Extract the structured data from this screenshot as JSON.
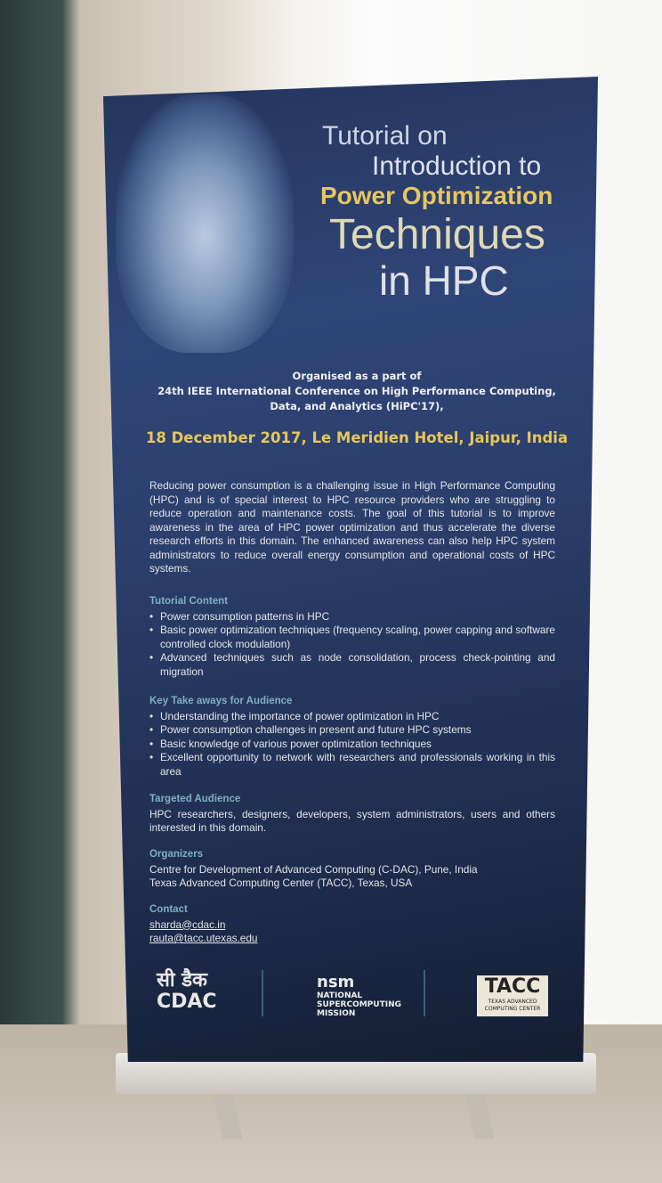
{
  "poster": {
    "title_line1": "Tutorial on",
    "title_line2": "Introduction to",
    "title_line3": "Power Optimization",
    "title_line4": "Techniques",
    "title_line5": "in HPC",
    "organised": [
      "Organised as a part of",
      "24th IEEE International Conference on High Performance Computing,",
      "Data, and Analytics (HiPC'17),"
    ],
    "date_venue": "18 December 2017, Le Meridien Hotel, Jaipur, India",
    "intro": "Reducing power consumption is a challenging issue in High Performance Computing (HPC) and is of special interest to HPC resource providers who are struggling to reduce operation and maintenance costs. The goal of this tutorial is to improve awareness in the area of HPC power optimization and thus accelerate the diverse research efforts in this domain. The enhanced awareness can also help HPC system administrators to reduce overall energy consumption and operational costs of HPC systems.",
    "content": {
      "heading": "Tutorial Content",
      "items": [
        "Power consumption patterns in HPC",
        "Basic power optimization techniques (frequency scaling, power capping and software controlled clock modulation)",
        "Advanced techniques such as node consolidation, process check-pointing and migration"
      ]
    },
    "takeaways": {
      "heading": "Key Take aways for Audience",
      "items": [
        "Understanding the importance of power optimization in HPC",
        "Power consumption challenges in present and future HPC systems",
        "Basic knowledge of various power optimization techniques",
        "Excellent opportunity to network with researchers and professionals working in this area"
      ]
    },
    "audience": {
      "heading": "Targeted Audience",
      "text": "HPC researchers, designers, developers, system administrators, users and others interested in this domain."
    },
    "organizers": {
      "heading": "Organizers",
      "items": [
        "Centre for Development of Advanced Computing (C-DAC), Pune, India",
        "Texas Advanced Computing Center (TACC), Texas, USA"
      ]
    },
    "contact": {
      "heading": "Contact",
      "emails": [
        "sharda@cdac.in",
        "rauta@tacc.utexas.edu"
      ]
    },
    "logos": {
      "cdac_hindi": "सी डैक",
      "cdac": "CDAC",
      "nsm": "nsm",
      "nsm_text": [
        "NATIONAL",
        "SUPERCOMPUTING",
        "MISSION"
      ],
      "tacc": "TACC",
      "tacc_text": "TEXAS ADVANCED COMPUTING CENTER"
    },
    "colors": {
      "banner": "#2b3f6c",
      "accent_gold": "#e6c65a",
      "heading_teal": "#7fb0c4"
    }
  }
}
